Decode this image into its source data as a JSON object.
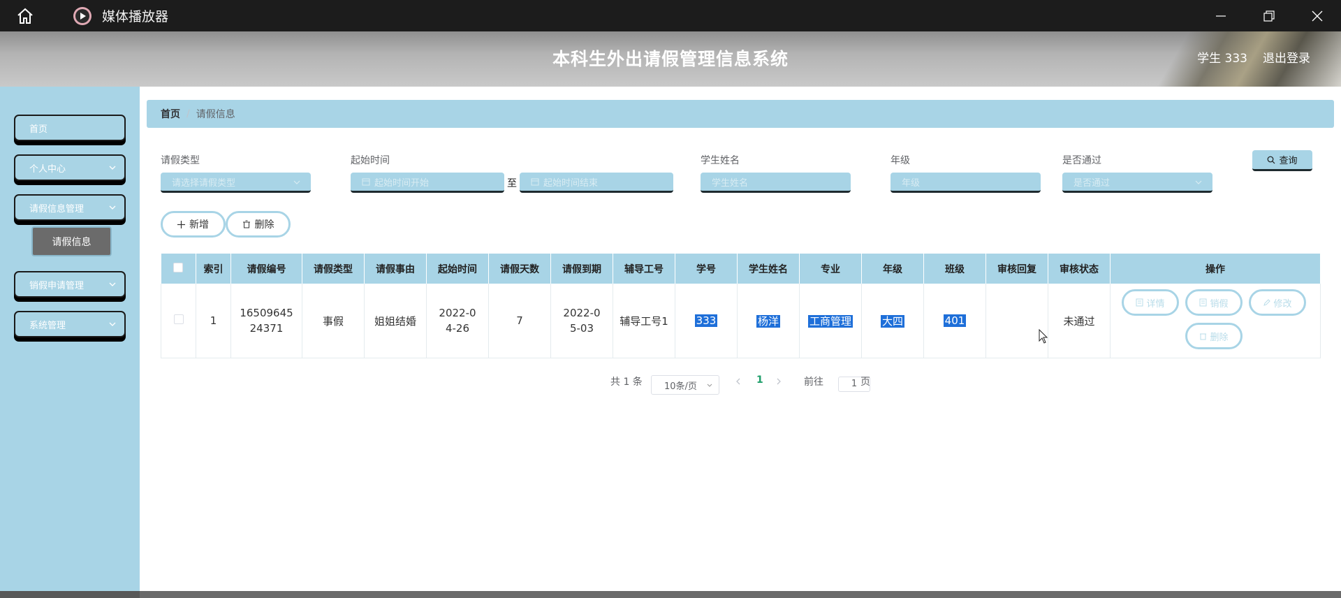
{
  "titlebar": {
    "app_title": "媒体播放器"
  },
  "header": {
    "system_title": "本科生外出请假管理信息系统",
    "user": "学生 333",
    "logout": "退出登录"
  },
  "sidebar": {
    "items": [
      {
        "label": "首页"
      },
      {
        "label": "个人中心"
      },
      {
        "label": "请假信息管理"
      },
      {
        "label": "销假申请管理"
      },
      {
        "label": "系统管理"
      }
    ],
    "submenu": {
      "label": "请假信息"
    }
  },
  "breadcrumb": {
    "home": "首页",
    "sep": "/",
    "current": "请假信息"
  },
  "filters": {
    "leave_type": {
      "label": "请假类型",
      "placeholder": "请选择请假类型"
    },
    "start_time": {
      "label": "起始时间",
      "start_placeholder": "起始时间开始",
      "end_placeholder": "起始时间结束",
      "to": "至"
    },
    "student_name": {
      "label": "学生姓名",
      "placeholder": "学生姓名"
    },
    "grade": {
      "label": "年级",
      "placeholder": "年级"
    },
    "approved": {
      "label": "是否通过",
      "placeholder": "是否通过"
    },
    "query_label": "查询"
  },
  "actions": {
    "add_label": "新增",
    "delete_label": "删除"
  },
  "table": {
    "columns": [
      "索引",
      "请假编号",
      "请假类型",
      "请假事由",
      "起始时间",
      "请假天数",
      "请假到期",
      "辅导工号",
      "学号",
      "学生姓名",
      "专业",
      "年级",
      "班级",
      "审核回复",
      "审核状态",
      "操作"
    ],
    "rows": [
      {
        "index": "1",
        "leave_no": "1650964524371",
        "leave_type": "事假",
        "reason": "姐姐结婚",
        "start": "2022-04-26",
        "days": "7",
        "expire": "2022-05-03",
        "advisor": "辅导工号1",
        "student_no": "333",
        "name": "杨洋",
        "major": "工商管理",
        "grade": "大四",
        "class": "401",
        "reply": "",
        "status": "未通过",
        "ops": {
          "detail": "详情",
          "cancel": "销假",
          "edit": "修改",
          "delete": "删除"
        }
      }
    ]
  },
  "pagination": {
    "total_text": "共 1 条",
    "page_size": "10条/页",
    "current_page": "1",
    "goto_label": "前往",
    "goto_value": "1",
    "page_suffix": "页"
  },
  "colors": {
    "accent": "#a8d4e6",
    "highlight": "#1e6fd9",
    "titlebar": "#1c1c1c"
  }
}
